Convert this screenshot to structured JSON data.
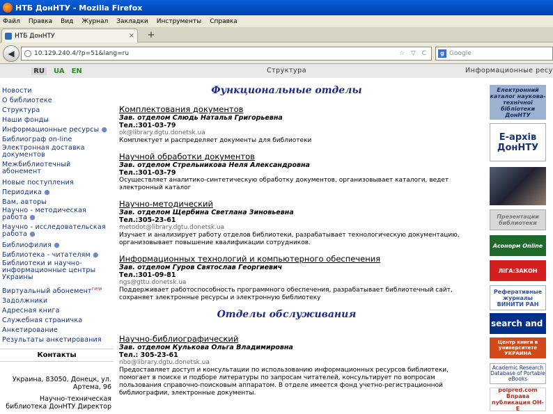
{
  "window": {
    "title": "НТБ ДонНТУ - Mozilla Firefox"
  },
  "menubar": [
    "Файл",
    "Правка",
    "Вид",
    "Журнал",
    "Закладки",
    "Инструменты",
    "Справка"
  ],
  "tab": {
    "title": "НТБ ДонНТУ",
    "close": "×",
    "new_tab": "+"
  },
  "navbar": {
    "back": "◀",
    "url": "10.129.240.4/?p=51&lang=ru",
    "url_tools": "☆ ▽ C",
    "search_placeholder": "Google",
    "search_engine": "g"
  },
  "langs": [
    "RU",
    "UA",
    "EN"
  ],
  "left_menu": [
    "Новости",
    "О библиотеке",
    "Структура",
    "Наши фонды",
    "Информационные ресурсы",
    "Библиограф on-line",
    "Электронная доставка документов",
    "Межбиблиотечный абонемент",
    "Новые поступления",
    "Периодика",
    "Вам, авторы",
    "Научно - методическая работа",
    "Научно - исследовательская работа",
    "Библиофилия",
    "Библиотека - читателям",
    "Библиотеки и научно-информационные центры Украины",
    "Виртуальный абонемент",
    "Задолжники",
    "Адресная книга",
    "Служебная страничка",
    "Анкетирование",
    "Результаты анкетирования"
  ],
  "new_badge": "new",
  "contacts": {
    "title": "Контакты",
    "address": "Украина, 83050, Донецк, ул. Артема, 96",
    "director": "Научно-техническая библиотека ДонНТУ Директор"
  },
  "middle": {
    "header": "Структура",
    "section1_title": "Функциональные отделы",
    "section2_title": "Отделы обслуживания",
    "depts1": [
      {
        "name": "Комплектования документов",
        "head": "Зав. отделом Слюдь Наталья Григорьевна",
        "tel": "Тел.:301-03-79",
        "email": "ok@library.dgtu.donetsk.ua",
        "desc": "Комплектует и распределяет документы для библиотеки"
      },
      {
        "name": "Научной обработки документов",
        "head": "Зав. отделом Стрельникова Неля Александровна",
        "tel": "Тел.:301-03-79",
        "email": "",
        "desc": "Осуществляет аналитико-синтетическую обработку документов, организовывает каталоги, ведет электронный каталог"
      },
      {
        "name": "Научно-методический",
        "head": "Зав. отделом Щербина Светлана Зиновьевна",
        "tel": "Тел.:305-23-61",
        "email": "metodot@library.dgtu.donetsk.ua",
        "desc": "Изучает и анализирует работу отделов библиотеки, разрабатывает технологическую документацию, организовывает повышение квалификации сотрудников."
      },
      {
        "name": "Информационных технологий и компьютерного обеспечения",
        "head": "Зав. отделом Гуров Святослав Георгиевич",
        "tel": "Тел.:301-09-81",
        "email": "ngs@gttu.donetsk.ua",
        "desc": "Поддерживает работоспособность программного обеспечения, разрабатывает библиотечный сайт, сохраняет электронные ресурсы и электронную библиотеку"
      }
    ],
    "depts2": [
      {
        "name": "Научно-библиографический",
        "head": "Зав. отделом Кулькова Ольга Владимировна",
        "tel": "Тел.: 305-23-61",
        "email": "nbo@library.dgtu.donetsk.ua",
        "desc": "Предоставляет доступ и консультации по использованию информационных ресурсов библиотеки, помогает в поиске и подборе литературы по запросам читателей, консультирует по вопросам пользования справочно-поисковым аппаратом. В отделе имеется фонд учетно-регистрационной библиографии, электронные документы."
      }
    ]
  },
  "right": {
    "header": "Информационные ресурсы",
    "banners": [
      "Електронний каталог наукова-технічної бібліотеки ДонНТУ",
      "Е-архів ДонНТУ",
      "",
      "Презентации библиотеки",
      "Асонорм Online",
      "ЛІГА:ЗАКОН",
      "Реферативные журналы ВИНИТИ РАН",
      "search and",
      "Центр книги в университете УКРАИНА",
      "Academic Research Database of Portable eBooks",
      "polpred.com Вправа публикация ОН-Е"
    ],
    "banner_colors": [
      "#9bb2d0",
      "#ffffff",
      "#303040",
      "#e0e0e0",
      "#1f6a2a",
      "#d52020",
      "#3050a0",
      "#00308a",
      "#d24a1a",
      "#ffffff",
      "#ffffff"
    ]
  }
}
